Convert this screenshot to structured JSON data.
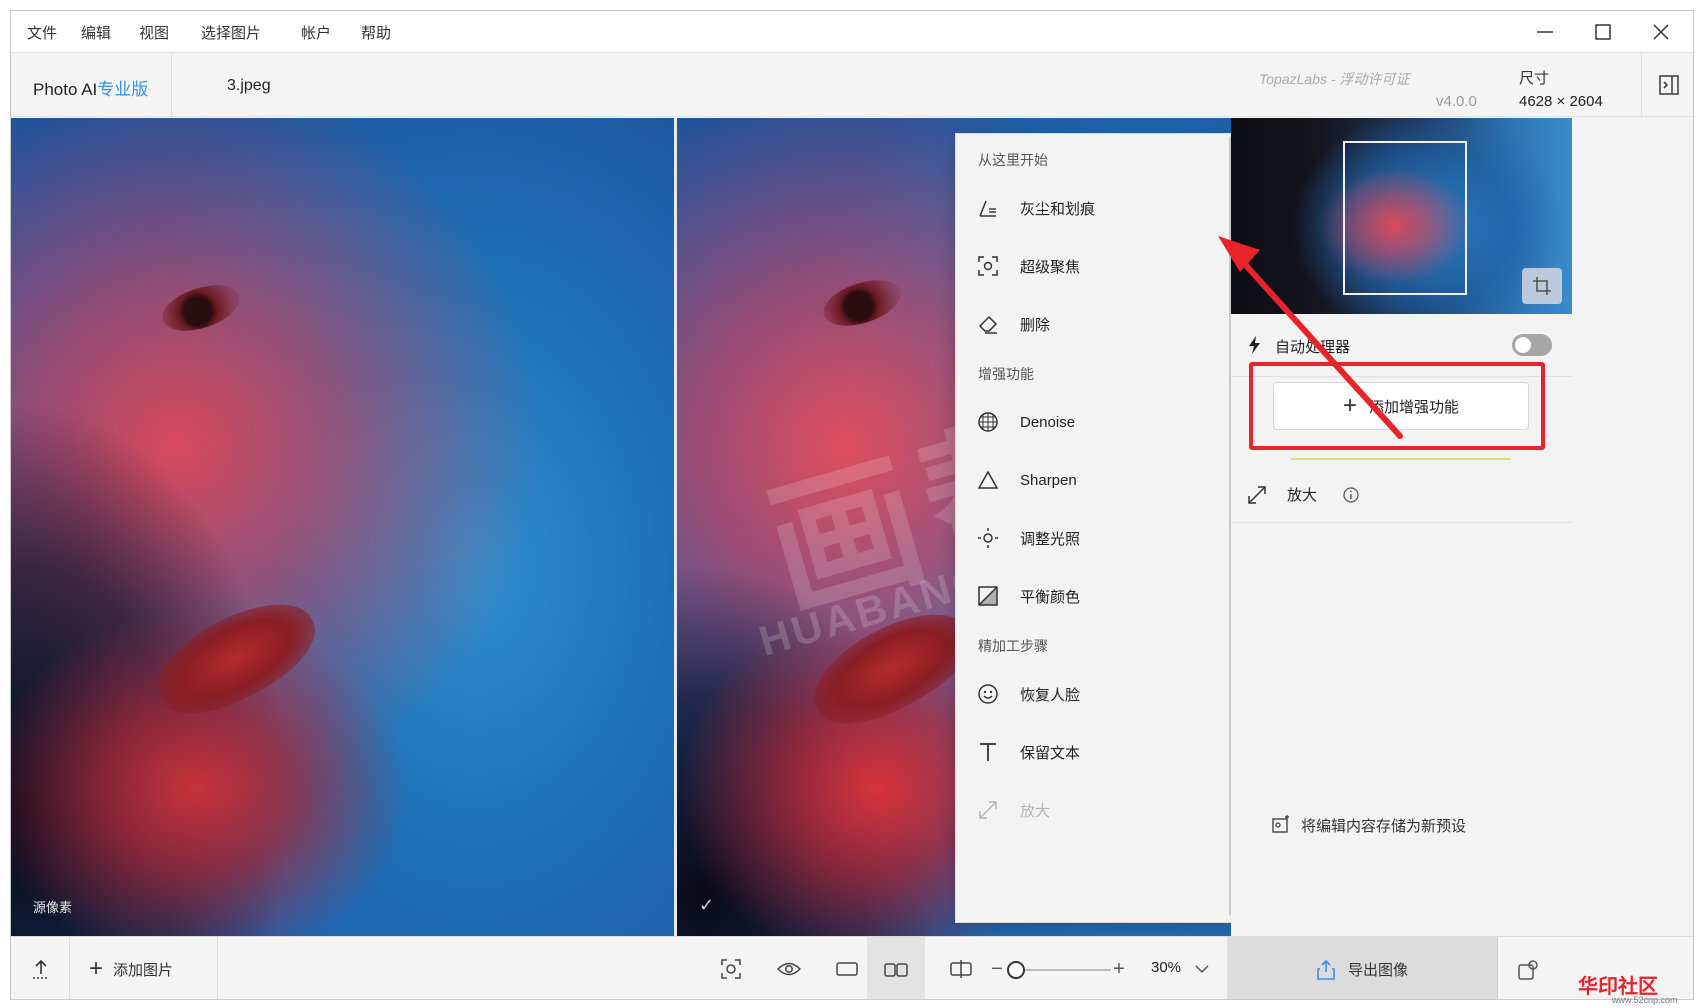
{
  "menubar": {
    "items": [
      "文件",
      "编辑",
      "视图",
      "选择图片",
      "帐户",
      "帮助"
    ]
  },
  "header": {
    "app_name": "Photo AI",
    "app_edition": "专业版",
    "file_name": "3.jpeg",
    "license": "TopazLabs - 浮动许可证",
    "version": "v4.0.0",
    "dimensions_label": "尺寸",
    "dimensions_value": "4628 × 2604"
  },
  "panes": {
    "left_caption": "源像素",
    "right_caption": "✓"
  },
  "watermark": {
    "text_cn": "画帮手",
    "text_en": "HUABANGSHOU.COM"
  },
  "dropdown": {
    "sections": [
      {
        "title": "从这里开始",
        "items": [
          {
            "label": "灰尘和划痕",
            "icon": "dust-scratch-icon",
            "disabled": false
          },
          {
            "label": "超级聚焦",
            "icon": "focus-icon",
            "disabled": false
          },
          {
            "label": "删除",
            "icon": "eraser-icon",
            "disabled": false
          }
        ]
      },
      {
        "title": "增强功能",
        "items": [
          {
            "label": "Denoise",
            "icon": "denoise-icon",
            "disabled": false
          },
          {
            "label": "Sharpen",
            "icon": "sharpen-icon",
            "disabled": false
          },
          {
            "label": "调整光照",
            "icon": "light-icon",
            "disabled": false
          },
          {
            "label": "平衡颜色",
            "icon": "color-balance-icon",
            "disabled": false
          }
        ]
      },
      {
        "title": "精加工步骤",
        "items": [
          {
            "label": "恢复人脸",
            "icon": "face-icon",
            "disabled": false
          },
          {
            "label": "保留文本",
            "icon": "text-icon",
            "disabled": false
          },
          {
            "label": "放大",
            "icon": "upscale-icon",
            "disabled": true
          }
        ]
      }
    ]
  },
  "sidebar": {
    "autopilot_label": "自动处理器",
    "autopilot_on": false,
    "add_enhancement_label": "添加增强功能",
    "upscale_label": "放大",
    "save_preset_label": "将编辑内容存储为新预设"
  },
  "bottombar": {
    "add_image_label": "添加图片",
    "zoom_value": "30%",
    "zoom_fraction": 0.05,
    "export_label": "导出图像"
  },
  "colors": {
    "accent_blue": "#3b8fe6",
    "highlight_red": "#e8232b"
  },
  "branding": {
    "corner_logo": "华印社区",
    "corner_url": "www.52cnp.com"
  }
}
